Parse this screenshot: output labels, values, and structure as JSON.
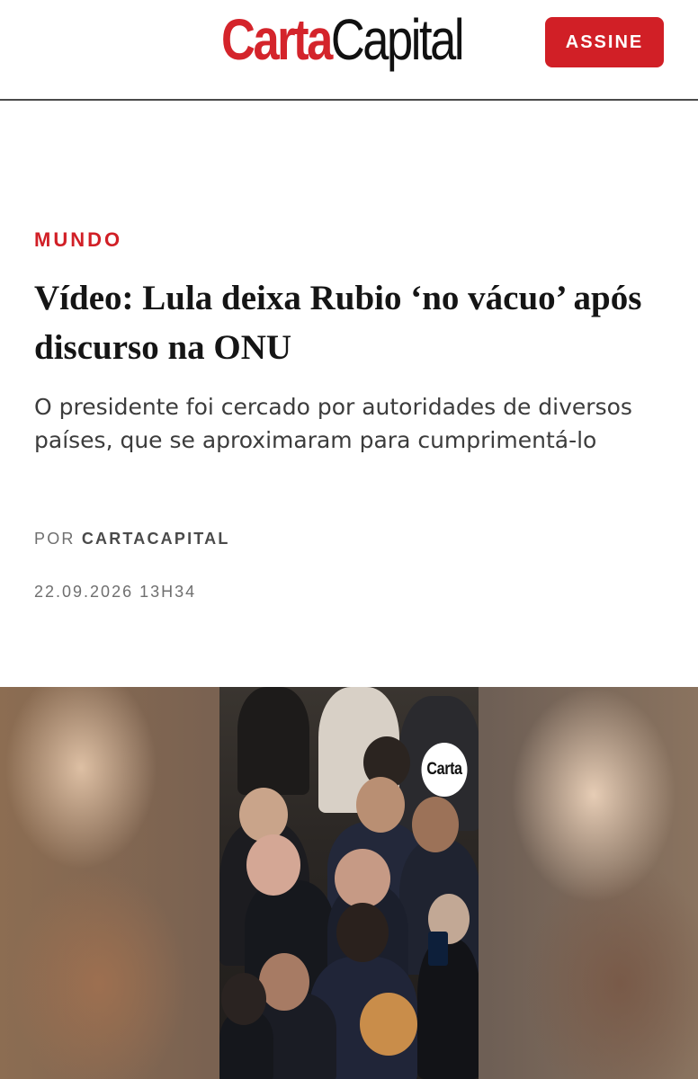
{
  "header": {
    "logo_part1": "Carta",
    "logo_part2": "Capital",
    "subscribe_label": "ASSINE"
  },
  "article": {
    "category": "MUNDO",
    "headline": "Vídeo: Lula deixa Rubio ‘no vácuo’ após discurso na ONU",
    "subtitle": "O presidente foi cercado por autoridades de diversos países, que se aproximaram para cumprimentá-lo",
    "byline_prefix": "POR",
    "author": "CARTACAPITAL",
    "date": "22.09.2026 13H34"
  },
  "video": {
    "watermark": "Carta"
  },
  "colors": {
    "brand_red": "#d11f26",
    "text_dark": "#151515",
    "text_muted": "#6f6f6f"
  }
}
